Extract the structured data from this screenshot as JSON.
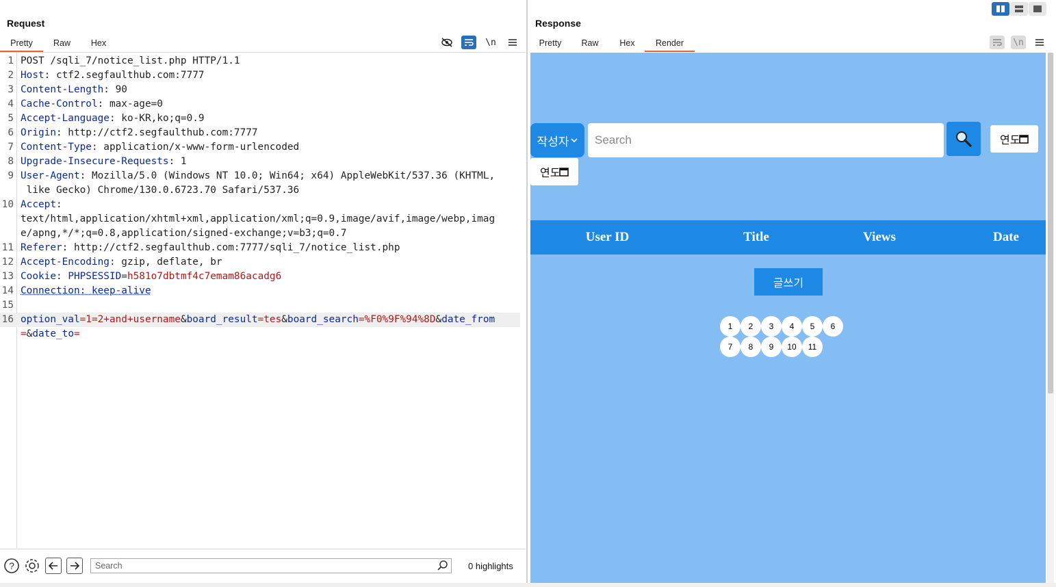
{
  "request": {
    "title": "Request",
    "tabs": [
      "Pretty",
      "Raw",
      "Hex"
    ],
    "active_tab": "Pretty",
    "tools": {
      "hide_icon": "eye-slash-icon",
      "wrap_icon": "wrap-icon",
      "newline_label": "\\n",
      "menu_icon": "menu-icon"
    },
    "lines": [
      {
        "n": "1",
        "parts": [
          {
            "t": "POST /sqli_7/notice_list.php HTTP/1.1",
            "c": "v"
          }
        ]
      },
      {
        "n": "2",
        "parts": [
          {
            "t": "Host",
            "c": "k"
          },
          {
            "t": ": ctf2.segfaulthub.com:7777",
            "c": "v"
          }
        ]
      },
      {
        "n": "3",
        "parts": [
          {
            "t": "Content-Length",
            "c": "k"
          },
          {
            "t": ": 90",
            "c": "v"
          }
        ]
      },
      {
        "n": "4",
        "parts": [
          {
            "t": "Cache-Control",
            "c": "k"
          },
          {
            "t": ": max-age=0",
            "c": "v"
          }
        ]
      },
      {
        "n": "5",
        "parts": [
          {
            "t": "Accept-Language",
            "c": "k"
          },
          {
            "t": ": ko-KR,ko;q=0.9",
            "c": "v"
          }
        ]
      },
      {
        "n": "6",
        "parts": [
          {
            "t": "Origin",
            "c": "k"
          },
          {
            "t": ": http://ctf2.segfaulthub.com:7777",
            "c": "v"
          }
        ]
      },
      {
        "n": "7",
        "parts": [
          {
            "t": "Content-Type",
            "c": "k"
          },
          {
            "t": ": application/x-www-form-urlencoded",
            "c": "v"
          }
        ]
      },
      {
        "n": "8",
        "parts": [
          {
            "t": "Upgrade-Insecure-Requests",
            "c": "k"
          },
          {
            "t": ": 1",
            "c": "v"
          }
        ]
      },
      {
        "n": "9",
        "parts": [
          {
            "t": "User-Agent",
            "c": "k"
          },
          {
            "t": ": Mozilla/5.0 (Windows NT 10.0; Win64; x64) AppleWebKit/537.36 (KHTML,",
            "c": "v"
          }
        ]
      },
      {
        "n": "",
        "parts": [
          {
            "t": " like Gecko) Chrome/130.0.6723.70 Safari/537.36",
            "c": "v"
          }
        ]
      },
      {
        "n": "10",
        "parts": [
          {
            "t": "Accept",
            "c": "k"
          },
          {
            "t": ":",
            "c": "v"
          }
        ]
      },
      {
        "n": "",
        "parts": [
          {
            "t": "text/html,application/xhtml+xml,application/xml;q=0.9,image/avif,image/webp,imag",
            "c": "v"
          }
        ]
      },
      {
        "n": "",
        "parts": [
          {
            "t": "e/apng,*/*;q=0.8,application/signed-exchange;v=b3;q=0.7",
            "c": "v"
          }
        ]
      },
      {
        "n": "11",
        "parts": [
          {
            "t": "Referer",
            "c": "k"
          },
          {
            "t": ": http://ctf2.segfaulthub.com:7777/sqli_7/notice_list.php",
            "c": "v"
          }
        ]
      },
      {
        "n": "12",
        "parts": [
          {
            "t": "Accept-Encoding",
            "c": "k"
          },
          {
            "t": ": gzip, deflate, br",
            "c": "v"
          }
        ]
      },
      {
        "n": "13",
        "parts": [
          {
            "t": "Cookie",
            "c": "k"
          },
          {
            "t": ": ",
            "c": "v"
          },
          {
            "t": "PHPSESSID",
            "c": "k"
          },
          {
            "t": "=",
            "c": "v"
          },
          {
            "t": "h581o7dbtmf4c7emam86acadg6",
            "c": "r"
          }
        ]
      },
      {
        "n": "14",
        "parts": [
          {
            "t": "Connection: keep-alive",
            "c": "k dot"
          }
        ]
      },
      {
        "n": "15",
        "parts": [
          {
            "t": "",
            "c": "v"
          }
        ]
      },
      {
        "n": "16",
        "hl": true,
        "parts": [
          {
            "t": "option_val",
            "c": "k"
          },
          {
            "t": "=1=2+and+username",
            "c": "r"
          },
          {
            "t": "&",
            "c": "v"
          },
          {
            "t": "board_result",
            "c": "k"
          },
          {
            "t": "=tes",
            "c": "r"
          },
          {
            "t": "&",
            "c": "v"
          },
          {
            "t": "board_search",
            "c": "k"
          },
          {
            "t": "=%F0%9F%94%8D",
            "c": "r"
          },
          {
            "t": "&",
            "c": "v"
          },
          {
            "t": "date_from",
            "c": "k"
          }
        ]
      },
      {
        "n": "",
        "parts": [
          {
            "t": "=",
            "c": "r"
          },
          {
            "t": "&",
            "c": "v"
          },
          {
            "t": "date_to",
            "c": "k"
          },
          {
            "t": "=",
            "c": "r"
          }
        ]
      }
    ],
    "bottom": {
      "search_placeholder": "Search",
      "highlights": "0 highlights"
    }
  },
  "response": {
    "title": "Response",
    "tabs": [
      "Pretty",
      "Raw",
      "Hex",
      "Render"
    ],
    "active_tab": "Render",
    "tools": {
      "wrap_icon": "wrap-icon",
      "newline_label": "\\n",
      "menu_icon": "menu-icon"
    },
    "render": {
      "author_select": "작성자",
      "search_placeholder": "Search",
      "date_label": "연도",
      "table_headers": [
        "User ID",
        "Title",
        "Views",
        "Date"
      ],
      "write_button": "글쓰기",
      "pages": [
        "1",
        "2",
        "3",
        "4",
        "5",
        "6",
        "7",
        "8",
        "9",
        "10",
        "11"
      ]
    }
  },
  "colors": {
    "accent": "#e8613c",
    "render_bg": "#84bdf4",
    "primary": "#1e88e5",
    "key": "#0b2a9a",
    "value_red": "#b21818"
  }
}
